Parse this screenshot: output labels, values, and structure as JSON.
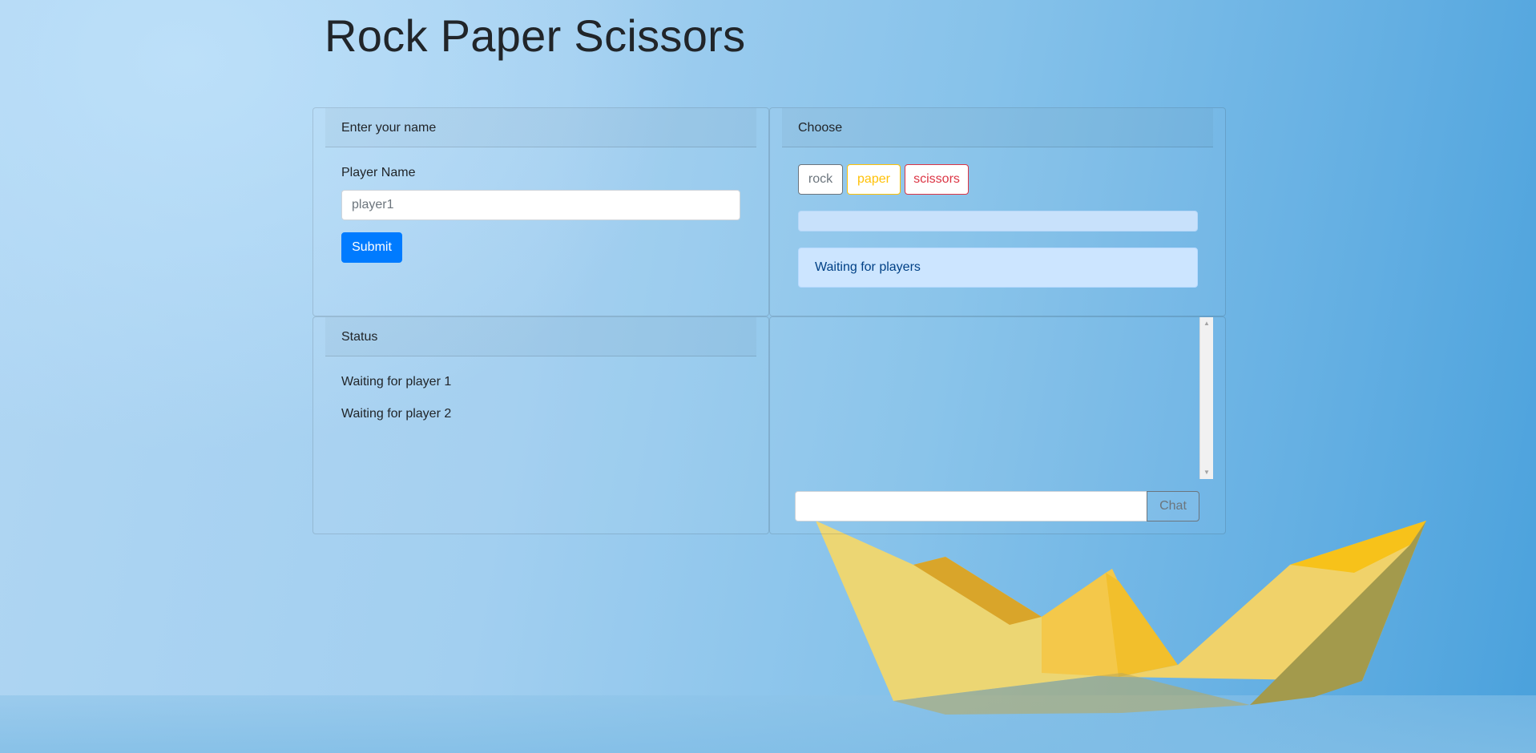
{
  "title": "Rock Paper Scissors",
  "name_card": {
    "header": "Enter your name",
    "field_label": "Player Name",
    "input_placeholder": "player1",
    "submit_label": "Submit"
  },
  "choose_card": {
    "header": "Choose",
    "choices": [
      "rock",
      "paper",
      "scissors"
    ],
    "progress": 0,
    "alert": "Waiting for players"
  },
  "status_card": {
    "header": "Status",
    "lines": [
      "Waiting for player 1",
      "Waiting for player 2"
    ]
  },
  "chat_card": {
    "input_value": "",
    "button_label": "Chat"
  },
  "colors": {
    "primary": "#007bff",
    "rock": "#6c757d",
    "paper": "#ffc107",
    "scissors": "#dc3545",
    "alert_bg": "#cce5ff"
  },
  "icons": [
    "scroll-up-arrow-icon",
    "scroll-down-arrow-icon",
    "paper-boat-image"
  ]
}
